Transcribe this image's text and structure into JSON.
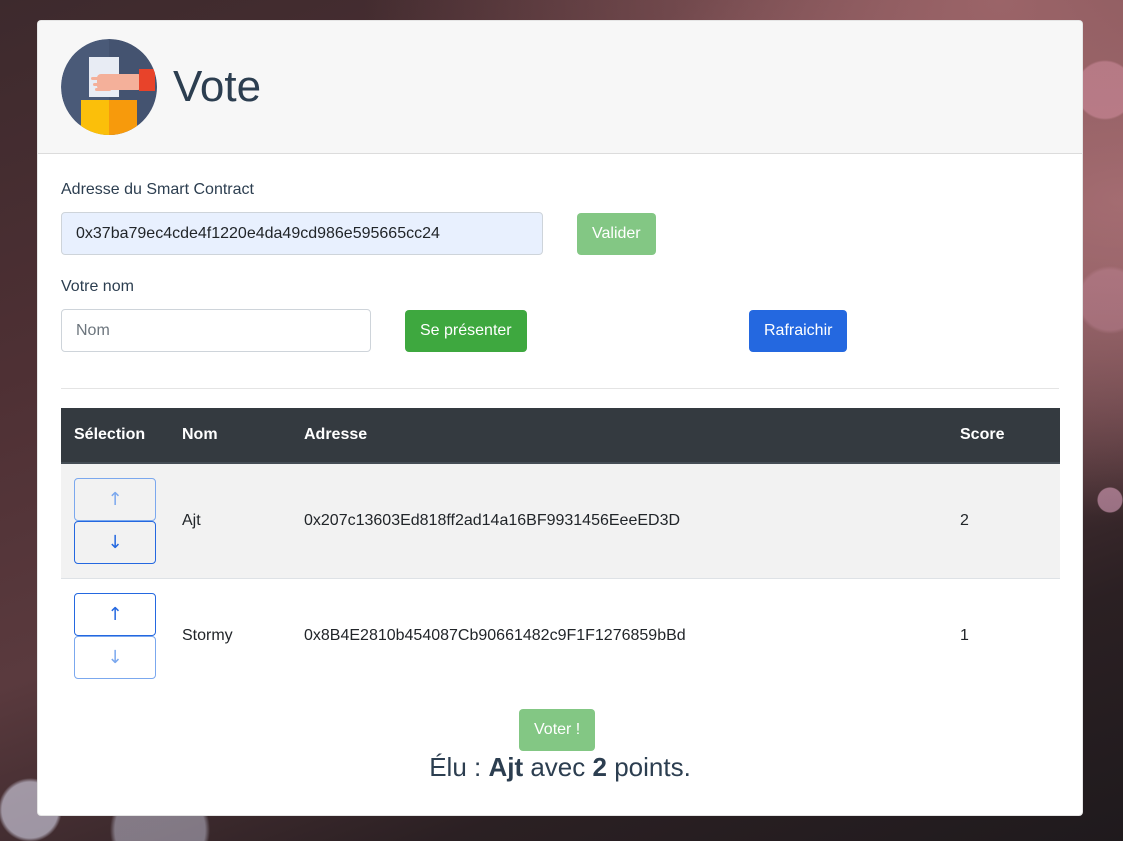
{
  "header": {
    "title": "Vote",
    "logo_icon": "ballot-box-hand-icon"
  },
  "contract": {
    "label": "Adresse du Smart Contract",
    "value": "0x37ba79ec4cde4f1220e4da49cd986e595665cc24",
    "validate_label": "Valider"
  },
  "register": {
    "label": "Votre nom",
    "placeholder": "Nom",
    "value": "",
    "present_label": "Se présenter",
    "refresh_label": "Rafraichir"
  },
  "table": {
    "columns": [
      "Sélection",
      "Nom",
      "Adresse",
      "Score"
    ],
    "rows": [
      {
        "name": "Ajt",
        "address": "0x207c13603Ed818ff2ad14a16BF9931456EeeED3D",
        "score": "2",
        "up_icon": "↑",
        "down_icon": "↓",
        "up_enabled": false,
        "down_enabled": true
      },
      {
        "name": "Stormy",
        "address": "0x8B4E2810b454087Cb90661482c9F1F1276859bBd",
        "score": "1",
        "up_icon": "↑",
        "down_icon": "↓",
        "up_enabled": true,
        "down_enabled": false
      }
    ]
  },
  "vote": {
    "button_label": "Voter !",
    "result_prefix": "Élu : ",
    "elected_name": "Ajt",
    "result_middle": " avec ",
    "elected_points": "2",
    "result_suffix": " points."
  },
  "colors": {
    "primary": "#2468e0",
    "success": "#3ea83f",
    "success_disabled": "#83c784",
    "table_header": "#343a40",
    "text_heading": "#2c3e50"
  }
}
